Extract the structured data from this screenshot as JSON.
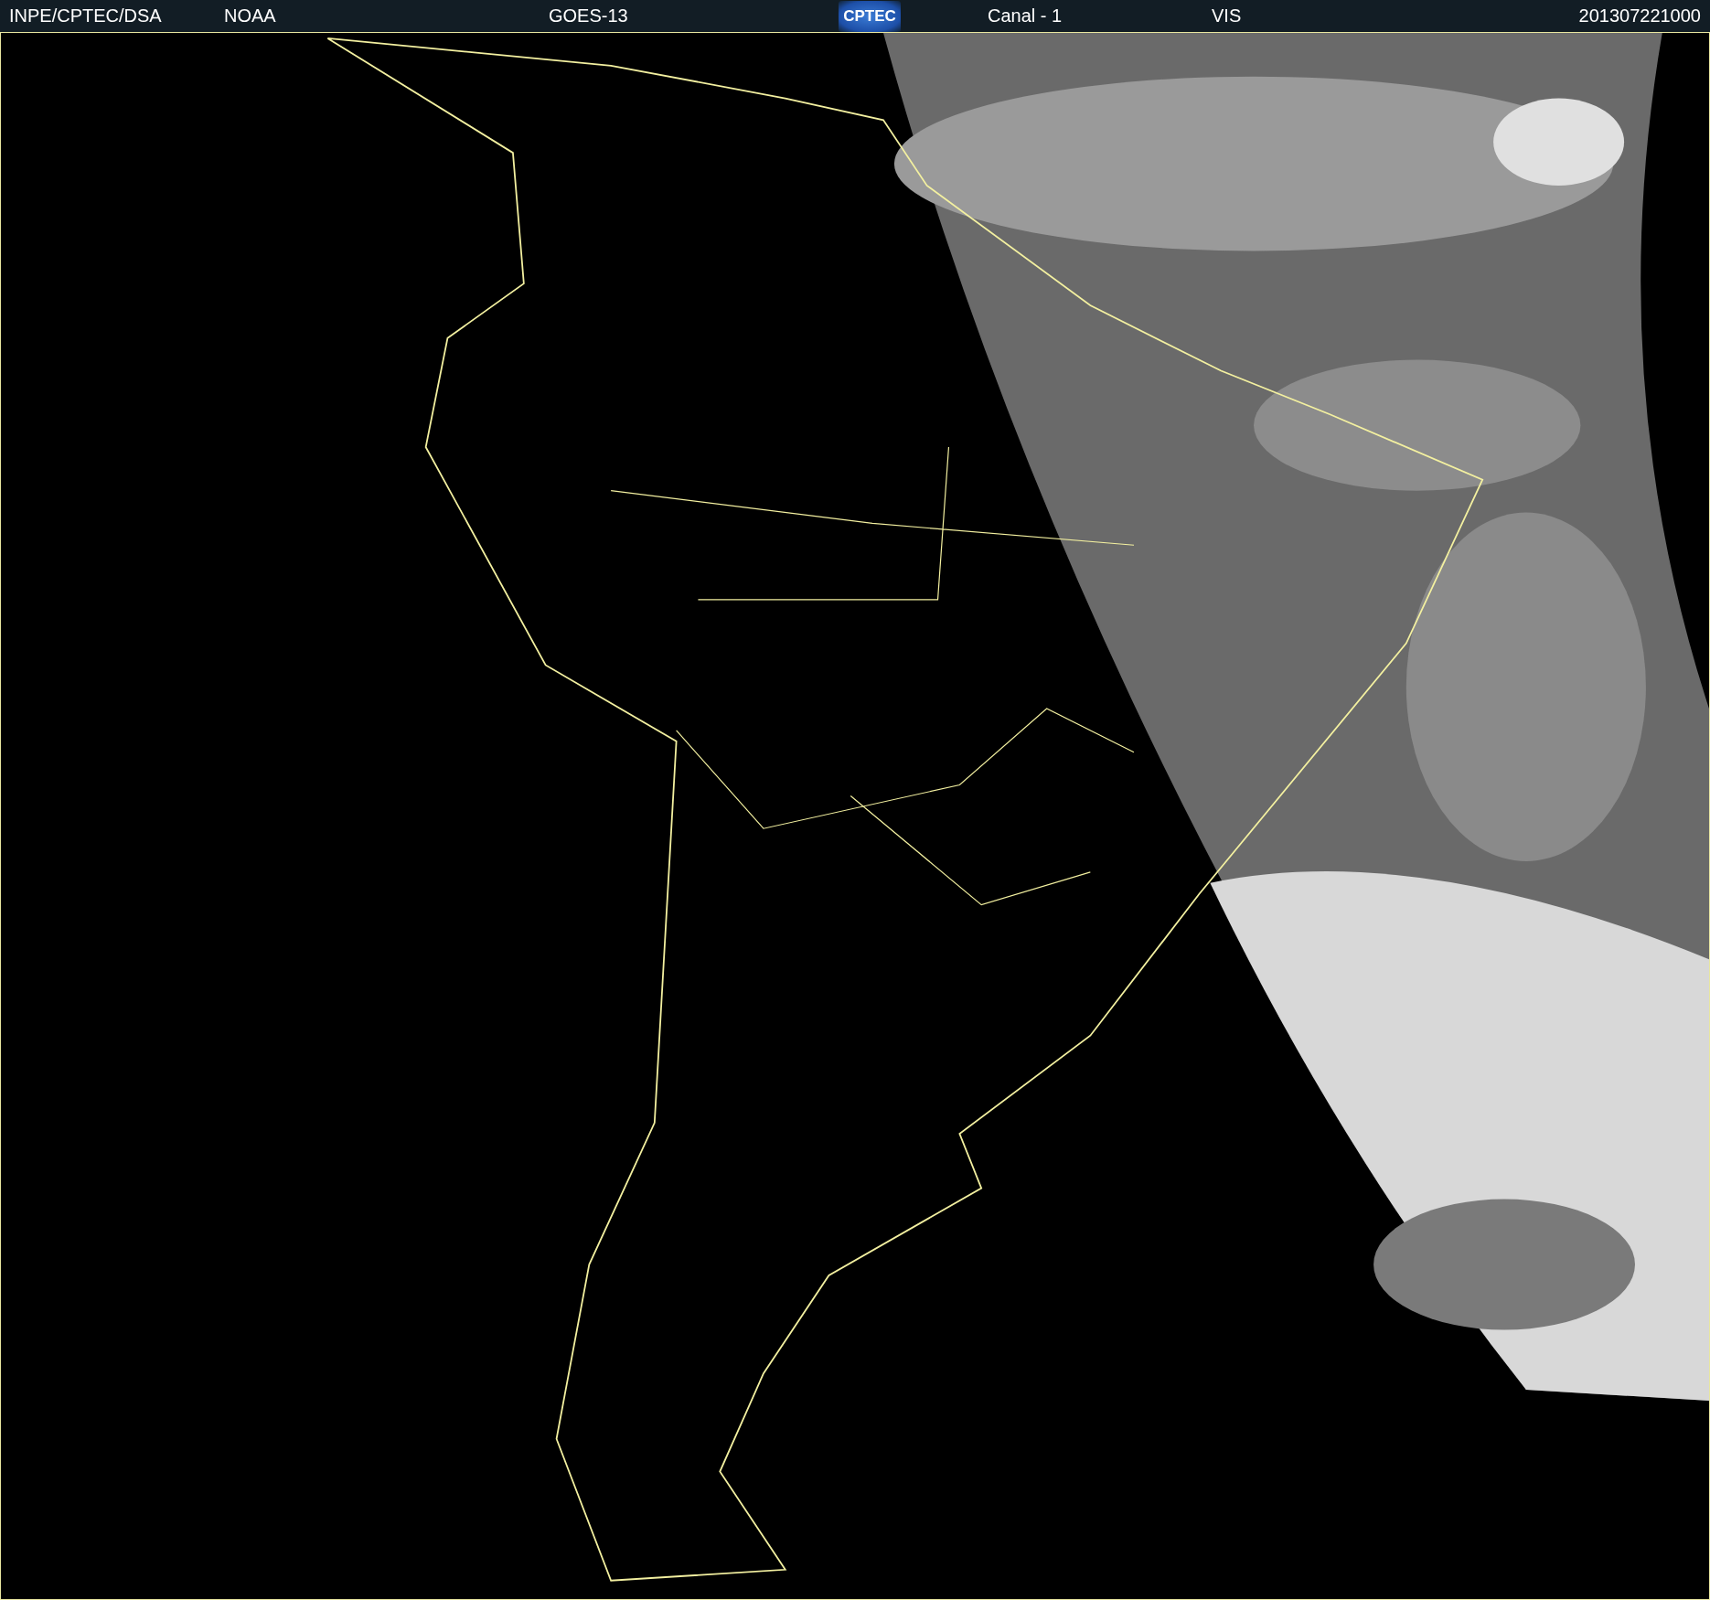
{
  "header": {
    "labels": [
      "INPE/CPTEC/DSA",
      "NOAA",
      "GOES-13"
    ],
    "logo": "CPTEC",
    "channel": "Canal - 1",
    "band": "VIS",
    "timestamp": "201307221000"
  }
}
